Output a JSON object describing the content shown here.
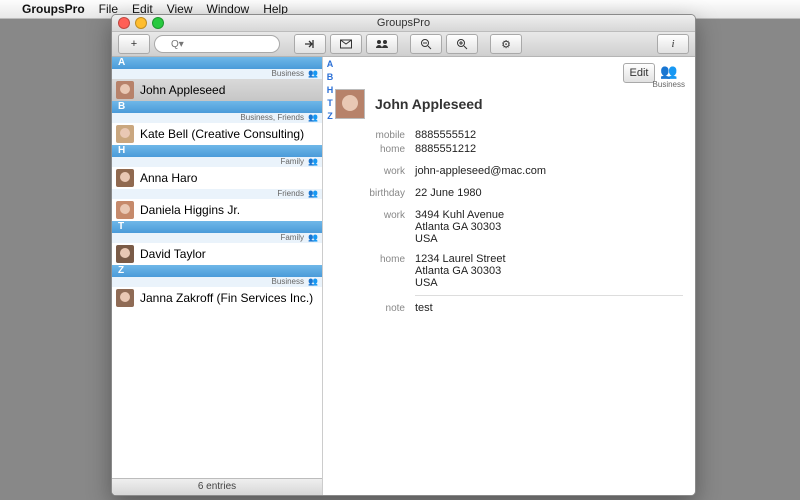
{
  "menubar": {
    "app": "GroupsPro",
    "items": [
      "File",
      "Edit",
      "View",
      "Window",
      "Help"
    ]
  },
  "window": {
    "title": "GroupsPro"
  },
  "toolbar": {
    "add": "+",
    "search_placeholder": "Q▾",
    "info": "i"
  },
  "index_letters": [
    "A",
    "B",
    "H",
    "T",
    "Z"
  ],
  "sections": [
    {
      "letter": "A",
      "tag": "Business",
      "rows": [
        {
          "name": "John Appleseed"
        }
      ]
    },
    {
      "letter": "B",
      "tag": "Business, Friends",
      "rows": [
        {
          "name": "Kate Bell (Creative Consulting)"
        }
      ]
    },
    {
      "letter": "H",
      "rows": [
        {
          "name": "Anna Haro",
          "tag": "Family"
        },
        {
          "name": "Daniela Higgins Jr.",
          "tag": "Friends"
        }
      ]
    },
    {
      "letter": "T",
      "tag": "Family",
      "rows": [
        {
          "name": "David Taylor"
        }
      ]
    },
    {
      "letter": "Z",
      "tag": "Business",
      "rows": [
        {
          "name": "Janna Zakroff (Fin Services Inc.)"
        }
      ]
    }
  ],
  "footer": "6 entries",
  "detail": {
    "edit": "Edit",
    "badge": "Business",
    "name": "John Appleseed",
    "fields": [
      {
        "lab": "mobile",
        "val": "8885555512"
      },
      {
        "lab": "home",
        "val": "8885551212"
      }
    ],
    "email": {
      "lab": "work",
      "val": "john-appleseed@mac.com"
    },
    "birthday": {
      "lab": "birthday",
      "val": "22 June 1980"
    },
    "addresses": [
      {
        "lab": "work",
        "lines": [
          "3494 Kuhl Avenue",
          "Atlanta GA 30303",
          "USA"
        ]
      },
      {
        "lab": "home",
        "lines": [
          "1234 Laurel Street",
          "Atlanta GA 30303",
          "USA"
        ]
      }
    ],
    "note": {
      "lab": "note",
      "val": "test"
    }
  }
}
